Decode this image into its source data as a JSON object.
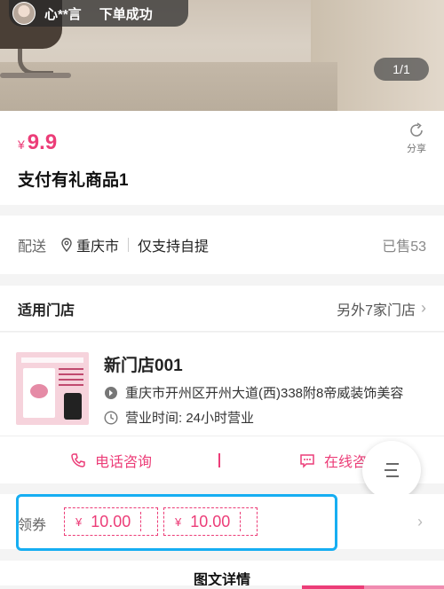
{
  "hero": {
    "order_notice": {
      "user": "心**言",
      "text": "下单成功"
    },
    "page_indicator": "1/1"
  },
  "product": {
    "currency": "¥",
    "price": "9.9",
    "name": "支付有礼商品1",
    "share_label": "分享"
  },
  "delivery": {
    "label": "配送",
    "city": "重庆市",
    "pickup": "仅支持自提",
    "sold": "已售53"
  },
  "stores": {
    "title": "适用门店",
    "more": "另外7家门店",
    "store": {
      "name": "新门店001",
      "address": "重庆市开州区开州大道(西)338附8帝威装饰美容",
      "hours": "营业时间: 24小时营业",
      "phone_label": "电话咨询",
      "online_label": "在线咨"
    }
  },
  "coupons": {
    "label": "领券",
    "items": [
      {
        "currency": "¥",
        "value": "10.00"
      },
      {
        "currency": "¥",
        "value": "10.00"
      }
    ]
  },
  "details": {
    "title": "图文详情"
  },
  "colors": {
    "accent": "#ec3d78",
    "highlight": "#16aef2"
  },
  "icons": [
    "share-icon",
    "location-pin-icon",
    "address-icon",
    "clock-icon",
    "phone-icon",
    "chat-icon",
    "menu-icon",
    "chevron-right-icon"
  ]
}
